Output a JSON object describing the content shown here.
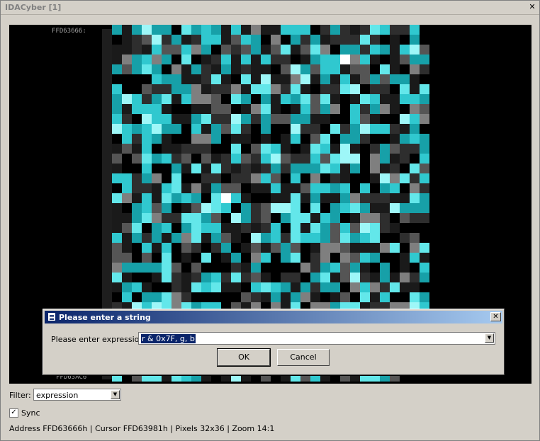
{
  "window": {
    "title": "IDACyber [1]",
    "close_glyph": "✕"
  },
  "view": {
    "top_address": "FFD63666:",
    "bottom_address": "FFD63AC6",
    "palette": [
      "#000000",
      "#1a1a1a",
      "#2e2e2e",
      "#555555",
      "#7f7f7f",
      "#17a0a8",
      "#30c8cf",
      "#63e7ea",
      "#9ef7f8",
      "#ffffff"
    ]
  },
  "filter": {
    "label": "Filter:",
    "value": "expression"
  },
  "sync": {
    "label": "Sync",
    "checked": true
  },
  "status": {
    "text": "Address FFD63666h | Cursor FFD63981h | Pixels 32x36  | Zoom 14:1"
  },
  "dialog": {
    "title": "Please enter a string",
    "prompt": "Please enter expression",
    "value": "r & 0x7F, g, b",
    "ok_label": "OK",
    "cancel_label": "Cancel"
  }
}
